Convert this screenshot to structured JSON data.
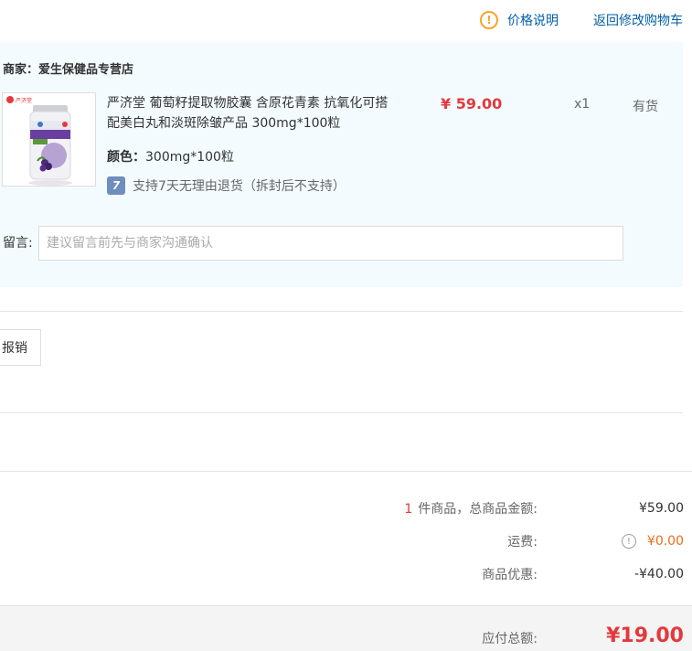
{
  "header": {
    "price_note": "价格说明",
    "back_link": "返回修改购物车"
  },
  "shop": {
    "vendor": "商家：爱生保健品专营店",
    "product": {
      "title": "严济堂 葡萄籽提取物胶囊 含原花青素 抗氧化可搭配美白丸和淡斑除皱产品 300mg*100粒",
      "price": "¥ 59.00",
      "quantity": "x1",
      "stock": "有货",
      "color_label": "颜色：",
      "color_value": "300mg*100粒",
      "return_policy": "支持7天无理由退货（拆封后不支持）",
      "image_brand": "严济堂"
    },
    "message_label": "留言:",
    "message_placeholder": "建议留言前先与商家沟通确认"
  },
  "reimburse_button": "报销",
  "summary": {
    "count": "1",
    "goods_label": "件商品，总商品金额:",
    "goods_value": "¥59.00",
    "shipping_label": "运费:",
    "shipping_value": "¥0.00",
    "discount_label": "商品优惠:",
    "discount_value": "-¥40.00",
    "total_label": "应付总额:",
    "total_value": "¥19.00"
  },
  "colors": {
    "accent_red": "#e4393c",
    "link_blue": "#005ea7",
    "panel_bg": "#f3fbfe",
    "warn_orange": "#f5a623"
  }
}
